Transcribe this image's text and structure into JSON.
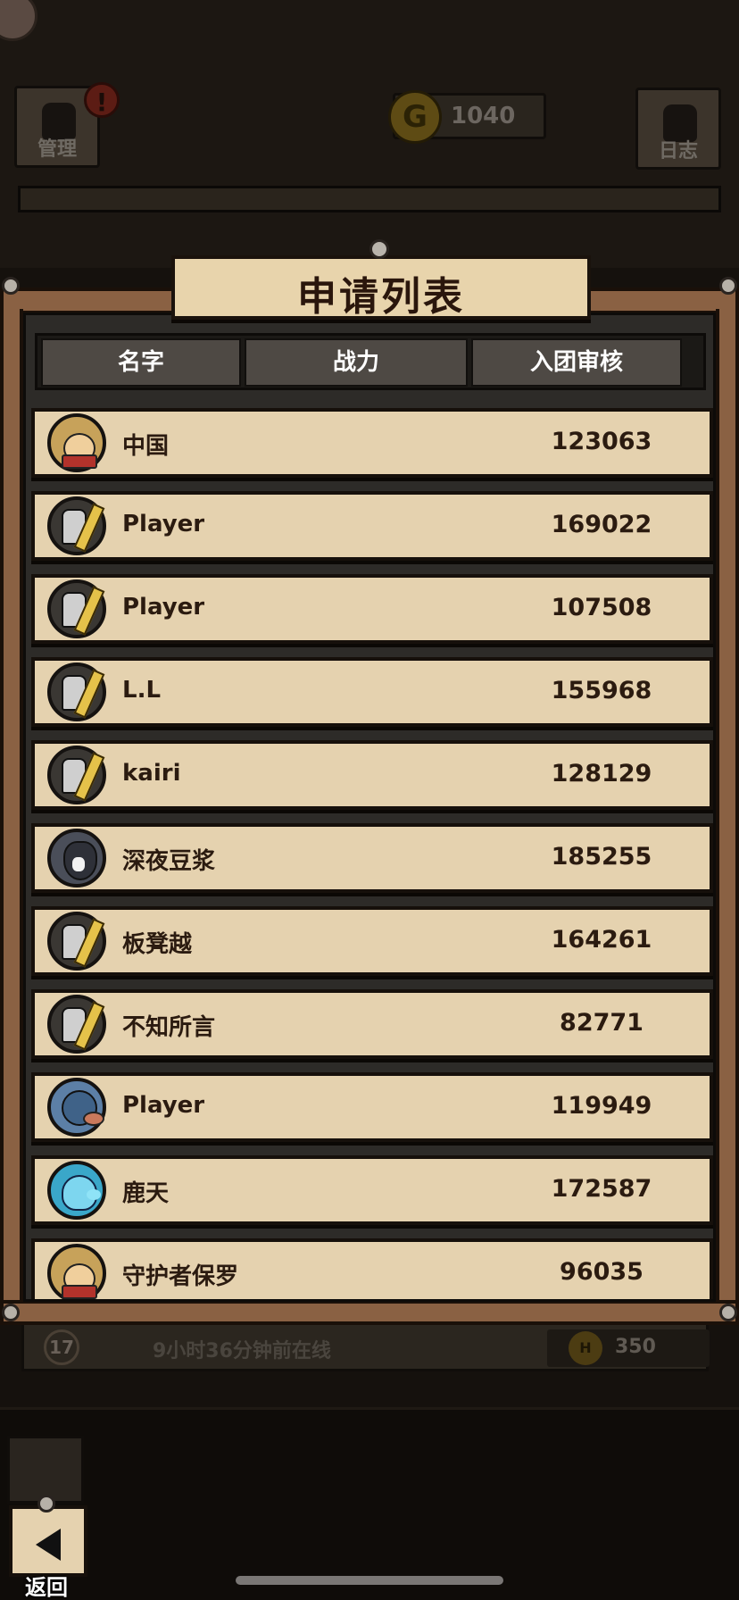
{
  "background": {
    "manage_label": "管理",
    "log_label": "日志",
    "alert_mark": "!",
    "gold_symbol": "G",
    "gold_value": "1040",
    "member_row": {
      "level": "17",
      "last_online": "9小时36分钟前在线",
      "points_symbol": "H",
      "points": "350"
    }
  },
  "dialog": {
    "title": "申请列表",
    "columns": [
      "名字",
      "战力",
      "入团审核"
    ],
    "applicants": [
      {
        "name": "中国",
        "power": "123063",
        "avatar": "monkey-avatar-icon"
      },
      {
        "name": "Player",
        "power": "169022",
        "avatar": "knight-avatar-icon"
      },
      {
        "name": "Player",
        "power": "107508",
        "avatar": "knight-avatar-icon"
      },
      {
        "name": "L.L",
        "power": "155968",
        "avatar": "knight-avatar-icon"
      },
      {
        "name": "kairi",
        "power": "128129",
        "avatar": "knight-avatar-icon"
      },
      {
        "name": "深夜豆浆",
        "power": "185255",
        "avatar": "wolf-avatar-icon"
      },
      {
        "name": "板凳越",
        "power": "164261",
        "avatar": "knight-avatar-icon"
      },
      {
        "name": "不知所言",
        "power": "82771",
        "avatar": "knight-avatar-icon"
      },
      {
        "name": "Player",
        "power": "119949",
        "avatar": "bird-avatar-icon"
      },
      {
        "name": "鹿天",
        "power": "172587",
        "avatar": "ghost-avatar-icon"
      },
      {
        "name": "守护者保罗",
        "power": "96035",
        "avatar": "monkey-avatar-icon"
      }
    ]
  },
  "footer": {
    "back_label": "返回",
    "back_icon": "back-arrow-icon"
  }
}
